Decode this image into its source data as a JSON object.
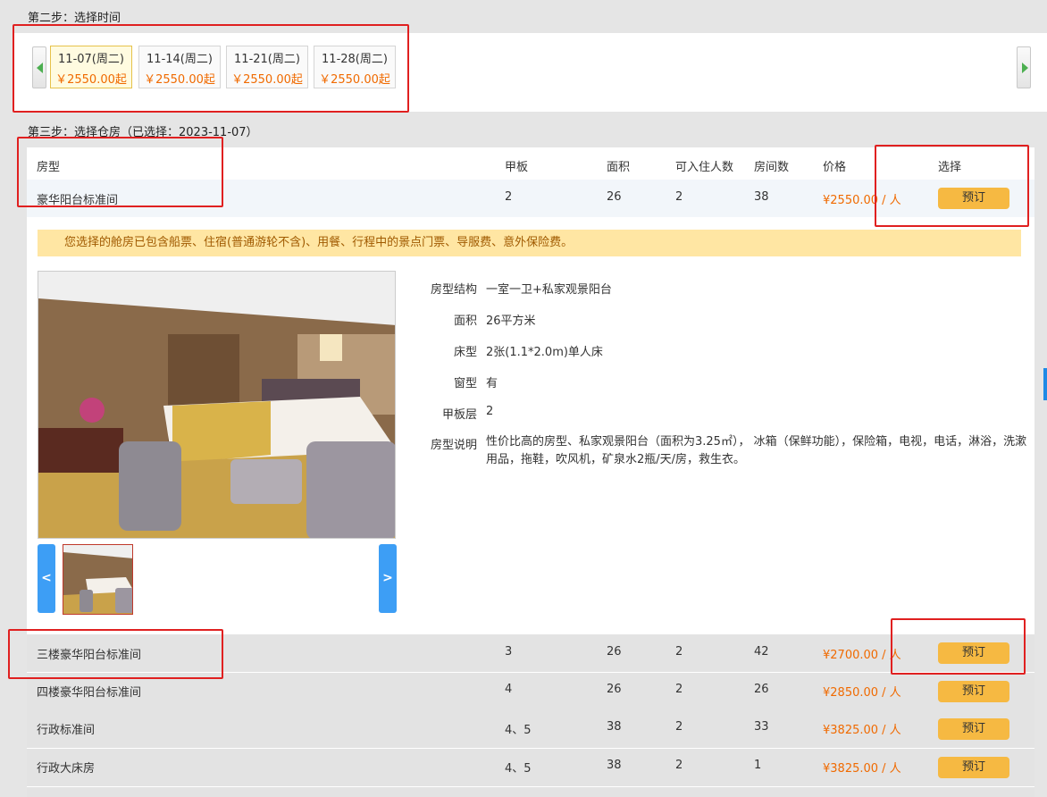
{
  "step2": {
    "title": "第二步：选择时间"
  },
  "dates": [
    {
      "date": "11-07(周二)",
      "price": "￥2550.00起",
      "selected": true
    },
    {
      "date": "11-14(周二)",
      "price": "￥2550.00起",
      "selected": false
    },
    {
      "date": "11-21(周二)",
      "price": "￥2550.00起",
      "selected": false
    },
    {
      "date": "11-28(周二)",
      "price": "￥2550.00起",
      "selected": false
    }
  ],
  "step3": {
    "title": "第三步：选择仓房（已选择：2023-11-07）"
  },
  "table": {
    "headers": {
      "room_type": "房型",
      "deck": "甲板",
      "area": "面积",
      "capacity": "可入住人数",
      "rooms": "房间数",
      "price": "价格",
      "select": "选择"
    },
    "book_label": "预订",
    "rows": [
      {
        "name": "豪华阳台标准间",
        "deck": "2",
        "area": "26",
        "capacity": "2",
        "rooms": "38",
        "price": "¥2550.00 / 人"
      },
      {
        "name": "三楼豪华阳台标准间",
        "deck": "3",
        "area": "26",
        "capacity": "2",
        "rooms": "42",
        "price": "¥2700.00 / 人"
      },
      {
        "name": "四楼豪华阳台标准间",
        "deck": "4",
        "area": "26",
        "capacity": "2",
        "rooms": "26",
        "price": "¥2850.00 / 人"
      },
      {
        "name": "行政标准间",
        "deck": "4、5",
        "area": "38",
        "capacity": "2",
        "rooms": "33",
        "price": "¥3825.00 / 人"
      },
      {
        "name": "行政大床房",
        "deck": "4、5",
        "area": "38",
        "capacity": "2",
        "rooms": "1",
        "price": "¥3825.00 / 人"
      }
    ]
  },
  "detail": {
    "notice": "您选择的舱房已包含船票、住宿(普通游轮不含)、用餐、行程中的景点门票、导服费、意外保险费。",
    "thumb_prev": "<",
    "thumb_next": ">",
    "specs": {
      "structure_label": "房型结构",
      "structure": "一室一卫+私家观景阳台",
      "area_label": "面积",
      "area": "26平方米",
      "bed_label": "床型",
      "bed": "2张(1.1*2.0m)单人床",
      "window_label": "窗型",
      "window": "有",
      "deck_label": "甲板层",
      "deck": "2",
      "desc_label": "房型说明",
      "desc": "性价比高的房型、私家观景阳台（面积为3.25㎡），  冰箱（保鲜功能），保险箱，电视，电话，淋浴，洗漱用品，拖鞋，吹风机，矿泉水2瓶/天/房，救生衣。"
    }
  },
  "colors": {
    "price": "#f06a00",
    "button": "#f6b942",
    "notice_bg": "#ffe6a3",
    "annotation": "#e02020"
  }
}
